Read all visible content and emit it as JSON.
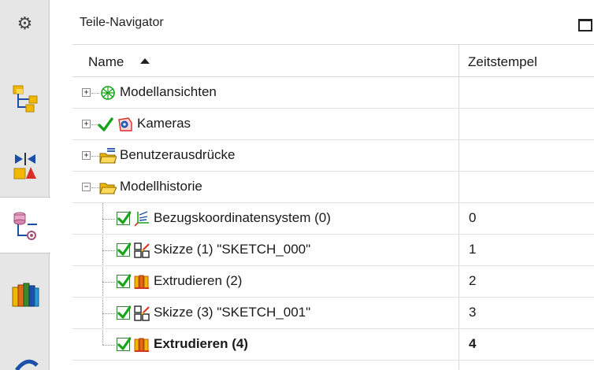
{
  "panel": {
    "title": "Teile-Navigator"
  },
  "columns": {
    "name": "Name",
    "timestamp": "Zeitstempel"
  },
  "tree": [
    {
      "label": "Modellansichten",
      "timestamp": "",
      "icon": "model-views-icon",
      "expander": "+"
    },
    {
      "label": "Kameras",
      "timestamp": "",
      "icon": "camera-icon",
      "expander": "+",
      "checked": true
    },
    {
      "label": "Benutzerausdrücke",
      "timestamp": "",
      "icon": "folder-expressions-icon",
      "expander": "+"
    },
    {
      "label": "Modellhistorie",
      "timestamp": "",
      "icon": "folder-open-icon",
      "expander": "−"
    },
    {
      "label": "Bezugskoordinatensystem (0)",
      "timestamp": "0",
      "icon": "datum-csys-icon",
      "checked": true
    },
    {
      "label": "Skizze (1) \"SKETCH_000\"",
      "timestamp": "1",
      "icon": "sketch-icon",
      "checked": true
    },
    {
      "label": "Extrudieren (2)",
      "timestamp": "2",
      "icon": "extrude-icon",
      "checked": true
    },
    {
      "label": "Skizze (3) \"SKETCH_001\"",
      "timestamp": "3",
      "icon": "sketch-icon",
      "checked": true
    },
    {
      "label": "Extrudieren (4)",
      "timestamp": "4",
      "icon": "extrude-icon",
      "checked": true,
      "bold": true
    }
  ],
  "resource_bar": [
    "settings-gear-icon",
    "assembly-navigator-icon",
    "constraint-navigator-icon",
    "part-navigator-icon",
    "reuse-library-icon",
    "history-icon"
  ],
  "colors": {
    "check": "#1aa31a",
    "folder": "#f2b800",
    "accent_red": "#d93025"
  }
}
